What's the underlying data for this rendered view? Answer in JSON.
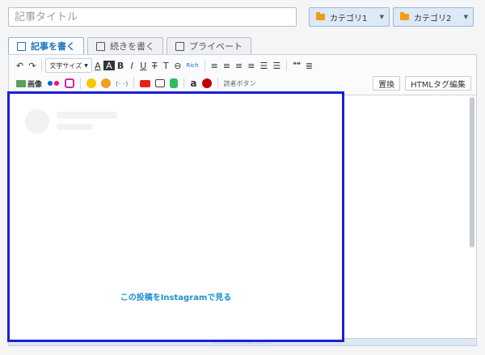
{
  "title_input": {
    "placeholder": "記事タイトル",
    "value": ""
  },
  "categories": [
    {
      "label": "カテゴリ1"
    },
    {
      "label": "カテゴリ2"
    }
  ],
  "tabs": [
    {
      "label": "記事を書く",
      "active": true
    },
    {
      "label": "続きを書く",
      "active": false
    },
    {
      "label": "プライベート",
      "active": false
    }
  ],
  "toolbar": {
    "undo": "↶",
    "redo": "↷",
    "font_size": "文字サイズ",
    "font_color": "A",
    "bg_color": "A",
    "bold": "B",
    "italic": "I",
    "underline": "U",
    "strike": "T",
    "unstrike": "T",
    "link": "⊖",
    "rich_link": "Rich",
    "align_left": "≡",
    "align_center": "≡",
    "align_right": "≡",
    "justify": "≡",
    "bullet_list": "☰",
    "numbered_list": "☰",
    "quote": "❝❝",
    "more": "≣",
    "image_label": "画像",
    "reader_button": "読者ボタン",
    "replace_label": "置換",
    "html_edit_label": "HTMLタグ編集"
  },
  "editor": {
    "embed_link_text": "この投稿をInstagramで見る"
  },
  "colors": {
    "accent": "#1e73be",
    "embed_border": "#1a1fd6",
    "instagram_link": "#1e8fd8",
    "folder": "#f39c12"
  }
}
